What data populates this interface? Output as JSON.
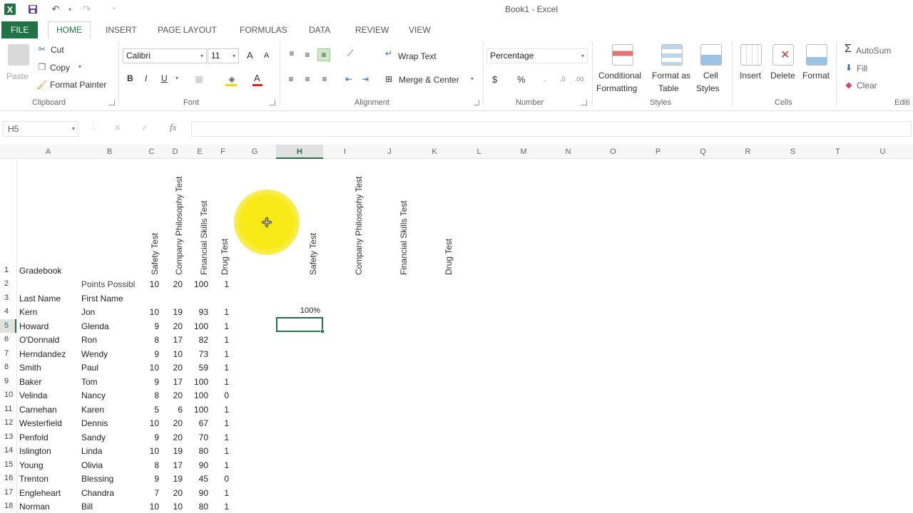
{
  "window": {
    "title": "Book1 - Excel"
  },
  "ribbon_tabs": [
    "FILE",
    "HOME",
    "INSERT",
    "PAGE LAYOUT",
    "FORMULAS",
    "DATA",
    "REVIEW",
    "VIEW"
  ],
  "clipboard": {
    "paste": "Paste",
    "cut": "Cut",
    "copy": "Copy",
    "format_painter": "Format Painter",
    "label": "Clipboard"
  },
  "font": {
    "name": "Calibri",
    "size": "11",
    "bold": "B",
    "italic": "I",
    "underline": "U",
    "grow": "A",
    "shrink": "A",
    "font_color": "A",
    "label": "Font"
  },
  "alignment": {
    "wrap_text": "Wrap Text",
    "merge_center": "Merge & Center",
    "label": "Alignment"
  },
  "number": {
    "format": "Percentage",
    "currency": "$",
    "percent": "%",
    "label": "Number"
  },
  "styles": {
    "conditional_1": "Conditional",
    "conditional_2": "Formatting",
    "format_table_1": "Format as",
    "format_table_2": "Table",
    "cell_styles_1": "Cell",
    "cell_styles_2": "Styles",
    "label": "Styles"
  },
  "cells_group": {
    "insert": "Insert",
    "delete": "Delete",
    "format": "Format",
    "label": "Cells"
  },
  "editing": {
    "autosum": "AutoSum",
    "fill": "Fill",
    "clear": "Clear",
    "label": "Editi"
  },
  "formula_bar": {
    "name_box": "H5",
    "fx": "fx",
    "value": ""
  },
  "columns": [
    "A",
    "B",
    "C",
    "D",
    "E",
    "F",
    "G",
    "H",
    "I",
    "J",
    "K",
    "L",
    "M",
    "N",
    "O",
    "P",
    "Q",
    "R",
    "S",
    "T",
    "U"
  ],
  "selected_column": "H",
  "selected_row": "5",
  "header_rotated": [
    "Safety Test",
    "Company Philosophy Test",
    "Financial Skills Test",
    "Drug Test"
  ],
  "header_rotated_copy": [
    "Safety Test",
    "Company Philosophy Test",
    "Financial Skills Test",
    "Drug Test"
  ],
  "sheet": {
    "title": "Gradebook",
    "points_label": "Points Possibl",
    "points": [
      "10",
      "20",
      "100",
      "1"
    ],
    "last_name_header": "Last Name",
    "first_name_header": "First Name",
    "h4_value": "100%",
    "rows": [
      {
        "row": "4",
        "last": "Kern",
        "first": "Jon",
        "c": "10",
        "d": "19",
        "e": "93",
        "f": "1"
      },
      {
        "row": "5",
        "last": "Howard",
        "first": "Glenda",
        "c": "9",
        "d": "20",
        "e": "100",
        "f": "1"
      },
      {
        "row": "6",
        "last": "O'Donnald",
        "first": "Ron",
        "c": "8",
        "d": "17",
        "e": "82",
        "f": "1"
      },
      {
        "row": "7",
        "last": "Herndandez",
        "first": "Wendy",
        "c": "9",
        "d": "10",
        "e": "73",
        "f": "1"
      },
      {
        "row": "8",
        "last": "Smith",
        "first": "Paul",
        "c": "10",
        "d": "20",
        "e": "59",
        "f": "1"
      },
      {
        "row": "9",
        "last": "Baker",
        "first": "Tom",
        "c": "9",
        "d": "17",
        "e": "100",
        "f": "1"
      },
      {
        "row": "10",
        "last": "Velinda",
        "first": "Nancy",
        "c": "8",
        "d": "20",
        "e": "100",
        "f": "0"
      },
      {
        "row": "11",
        "last": "Carnehan",
        "first": "Karen",
        "c": "5",
        "d": "6",
        "e": "100",
        "f": "1"
      },
      {
        "row": "12",
        "last": "Westerfield",
        "first": "Dennis",
        "c": "10",
        "d": "20",
        "e": "67",
        "f": "1"
      },
      {
        "row": "13",
        "last": "Penfold",
        "first": "Sandy",
        "c": "9",
        "d": "20",
        "e": "70",
        "f": "1"
      },
      {
        "row": "14",
        "last": "Islington",
        "first": "Linda",
        "c": "10",
        "d": "19",
        "e": "80",
        "f": "1"
      },
      {
        "row": "15",
        "last": "Young",
        "first": "Olivia",
        "c": "8",
        "d": "17",
        "e": "90",
        "f": "1"
      },
      {
        "row": "16",
        "last": "Trenton",
        "first": "Blessing",
        "c": "9",
        "d": "19",
        "e": "45",
        "f": "0"
      },
      {
        "row": "17",
        "last": "Engleheart",
        "first": "Chandra",
        "c": "7",
        "d": "20",
        "e": "90",
        "f": "1"
      },
      {
        "row": "18",
        "last": "Norman",
        "first": "Bill",
        "c": "10",
        "d": "10",
        "e": "80",
        "f": "1"
      }
    ],
    "row_labels": [
      "1",
      "2",
      "3"
    ]
  },
  "colors": {
    "excel_green": "#217346",
    "highlight_yellow": "#f7ea16"
  }
}
